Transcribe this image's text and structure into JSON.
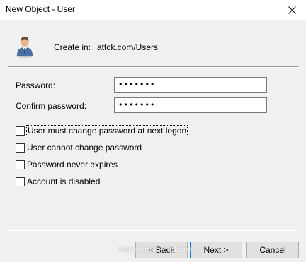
{
  "window": {
    "title": "New Object - User",
    "close_icon": "close-icon"
  },
  "header": {
    "icon": "user-icon",
    "create_in_label": "Create in:",
    "create_in_value": "attck.com/Users"
  },
  "fields": {
    "password_label": "Password:",
    "password_value": "•••••••",
    "confirm_label": "Confirm password:",
    "confirm_value": "•••••••"
  },
  "options": [
    {
      "label": "User must change password at next logon",
      "checked": false,
      "focused": true
    },
    {
      "label": "User cannot change password",
      "checked": false,
      "focused": false
    },
    {
      "label": "Password never expires",
      "checked": false,
      "focused": false
    },
    {
      "label": "Account is disabled",
      "checked": false,
      "focused": false
    }
  ],
  "buttons": {
    "back_label": "< Back",
    "next_label": "Next >",
    "cancel_label": "Cancel"
  },
  "watermark": "https://blog.csdn.net/..."
}
